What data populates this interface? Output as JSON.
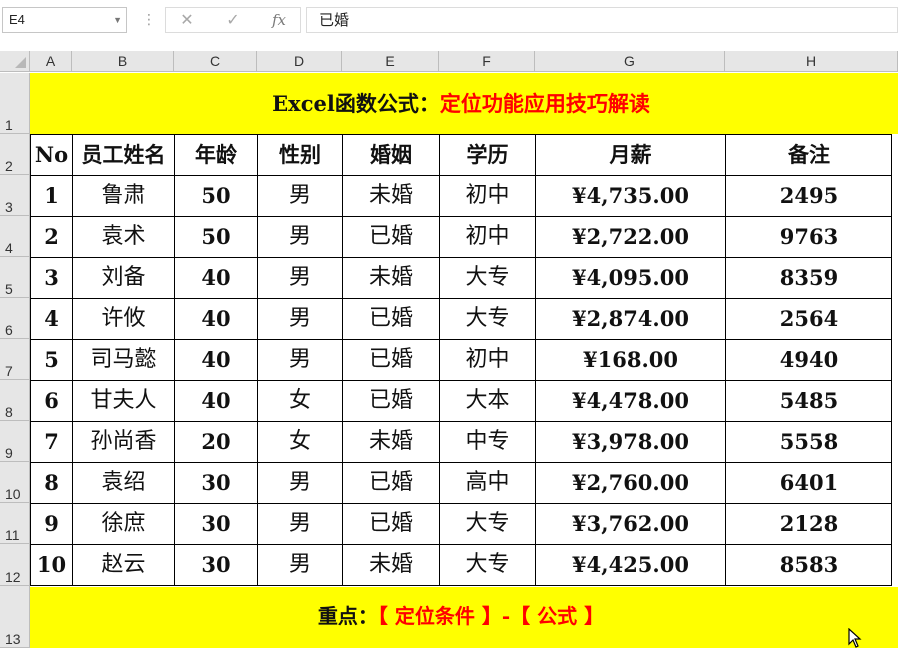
{
  "formula_bar": {
    "name_box": "E4",
    "cancel_icon": "✕",
    "enter_icon": "✓",
    "function_icon": "fx",
    "formula_value": "已婚"
  },
  "columns": [
    "A",
    "B",
    "C",
    "D",
    "E",
    "F",
    "G",
    "H"
  ],
  "rows": [
    "1",
    "2",
    "3",
    "4",
    "5",
    "6",
    "7",
    "8",
    "9",
    "10",
    "11",
    "12",
    "13"
  ],
  "title": {
    "black": "Excel函数公式：",
    "red": "定位功能应用技巧解读"
  },
  "table": {
    "headers": [
      "No",
      "员工姓名",
      "年龄",
      "性别",
      "婚姻",
      "学历",
      "月薪",
      "备注"
    ],
    "rows": [
      [
        "1",
        "鲁肃",
        "50",
        "男",
        "未婚",
        "初中",
        "¥4,735.00",
        "2495"
      ],
      [
        "2",
        "袁术",
        "50",
        "男",
        "已婚",
        "初中",
        "¥2,722.00",
        "9763"
      ],
      [
        "3",
        "刘备",
        "40",
        "男",
        "未婚",
        "大专",
        "¥4,095.00",
        "8359"
      ],
      [
        "4",
        "许攸",
        "40",
        "男",
        "已婚",
        "大专",
        "¥2,874.00",
        "2564"
      ],
      [
        "5",
        "司马懿",
        "40",
        "男",
        "已婚",
        "初中",
        "¥168.00",
        "4940"
      ],
      [
        "6",
        "甘夫人",
        "40",
        "女",
        "已婚",
        "大本",
        "¥4,478.00",
        "5485"
      ],
      [
        "7",
        "孙尚香",
        "20",
        "女",
        "未婚",
        "中专",
        "¥3,978.00",
        "5558"
      ],
      [
        "8",
        "袁绍",
        "30",
        "男",
        "已婚",
        "高中",
        "¥2,760.00",
        "6401"
      ],
      [
        "9",
        "徐庶",
        "30",
        "男",
        "已婚",
        "大专",
        "¥3,762.00",
        "2128"
      ],
      [
        "10",
        "赵云",
        "30",
        "男",
        "未婚",
        "大专",
        "¥4,425.00",
        "8583"
      ]
    ]
  },
  "footer": {
    "black": "重点：",
    "red": "【 定位条件 】-【 公式 】"
  },
  "colors": {
    "highlight": "#ffff00",
    "accent_text": "#ff0000"
  }
}
